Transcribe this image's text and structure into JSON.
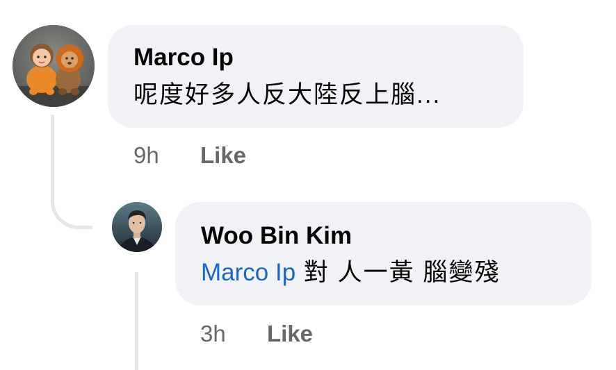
{
  "comment": {
    "author": "Marco Ip",
    "text": "呢度好多人反大陸反上腦...",
    "time": "9h",
    "like_label": "Like"
  },
  "reply": {
    "author": "Woo Bin Kim",
    "mention": "Marco Ip",
    "text": "對 人一黃 腦變殘",
    "time": "3h",
    "like_label": "Like"
  },
  "icons": {
    "comment_avatar": "plush-toys-avatar",
    "reply_avatar": "person-photo-avatar"
  },
  "colors": {
    "bubble_bg": "#f0f2f5",
    "mention": "#1b66c9",
    "meta_text": "#65676b",
    "thread_line": "#e4e6eb"
  }
}
